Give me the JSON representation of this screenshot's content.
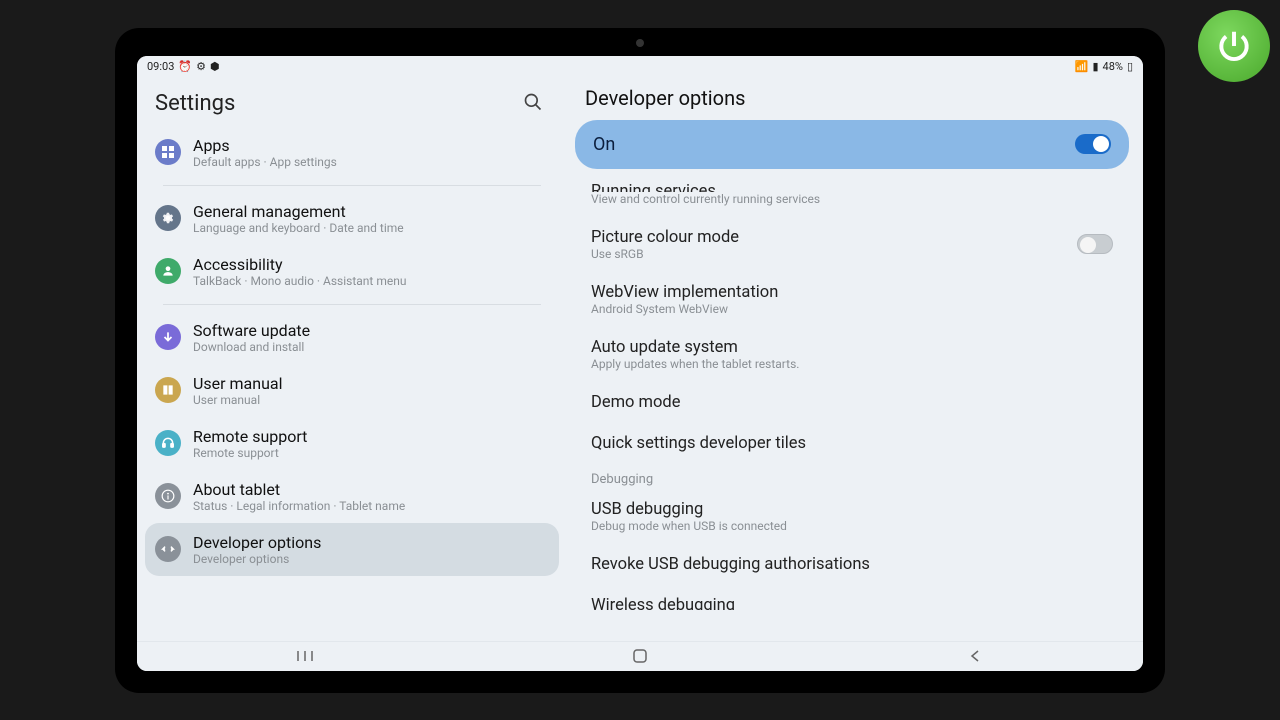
{
  "status": {
    "time": "09:03",
    "battery": "48%"
  },
  "settings_title": "Settings",
  "page_title": "Developer options",
  "master": {
    "label": "On",
    "state": true
  },
  "left_items": [
    {
      "id": "apps",
      "title": "Apps",
      "sub": "Default apps · App settings",
      "icon_bg": "#6b7cc9",
      "glyph": "grid",
      "cutoff": true
    },
    {
      "id": "general",
      "title": "General management",
      "sub": "Language and keyboard · Date and time",
      "icon_bg": "#64758a",
      "glyph": "cog",
      "sep_before": true
    },
    {
      "id": "accessibility",
      "title": "Accessibility",
      "sub": "TalkBack · Mono audio · Assistant menu",
      "icon_bg": "#3faa6a",
      "glyph": "person"
    },
    {
      "id": "software",
      "title": "Software update",
      "sub": "Download and install",
      "icon_bg": "#7a6bd8",
      "glyph": "arrow-down",
      "sep_before": true
    },
    {
      "id": "manual",
      "title": "User manual",
      "sub": "User manual",
      "icon_bg": "#caa64f",
      "glyph": "book"
    },
    {
      "id": "remote",
      "title": "Remote support",
      "sub": "Remote support",
      "icon_bg": "#4ab1c7",
      "glyph": "headset"
    },
    {
      "id": "about",
      "title": "About tablet",
      "sub": "Status · Legal information · Tablet name",
      "icon_bg": "#8a9199",
      "glyph": "info"
    },
    {
      "id": "developer",
      "title": "Developer options",
      "sub": "Developer options",
      "icon_bg": "#8a9199",
      "glyph": "code",
      "selected": true
    }
  ],
  "right_items": [
    {
      "id": "running",
      "title": "Running services",
      "sub": "View and control currently running services",
      "cutoff_top": true
    },
    {
      "id": "colour",
      "title": "Picture colour mode",
      "sub": "Use sRGB",
      "toggle": false
    },
    {
      "id": "webview",
      "title": "WebView implementation",
      "sub": "Android System WebView"
    },
    {
      "id": "auto-update",
      "title": "Auto update system",
      "sub": "Apply updates when the tablet restarts."
    },
    {
      "id": "demo",
      "title": "Demo mode"
    },
    {
      "id": "quick-tiles",
      "title": "Quick settings developer tiles"
    },
    {
      "id": "debugging-header",
      "section": "Debugging"
    },
    {
      "id": "usb-debug",
      "title": "USB debugging",
      "sub": "Debug mode when USB is connected"
    },
    {
      "id": "revoke",
      "title": "Revoke USB debugging authorisations"
    },
    {
      "id": "wireless",
      "title": "Wireless debugging",
      "cutoff_bot": true
    }
  ]
}
